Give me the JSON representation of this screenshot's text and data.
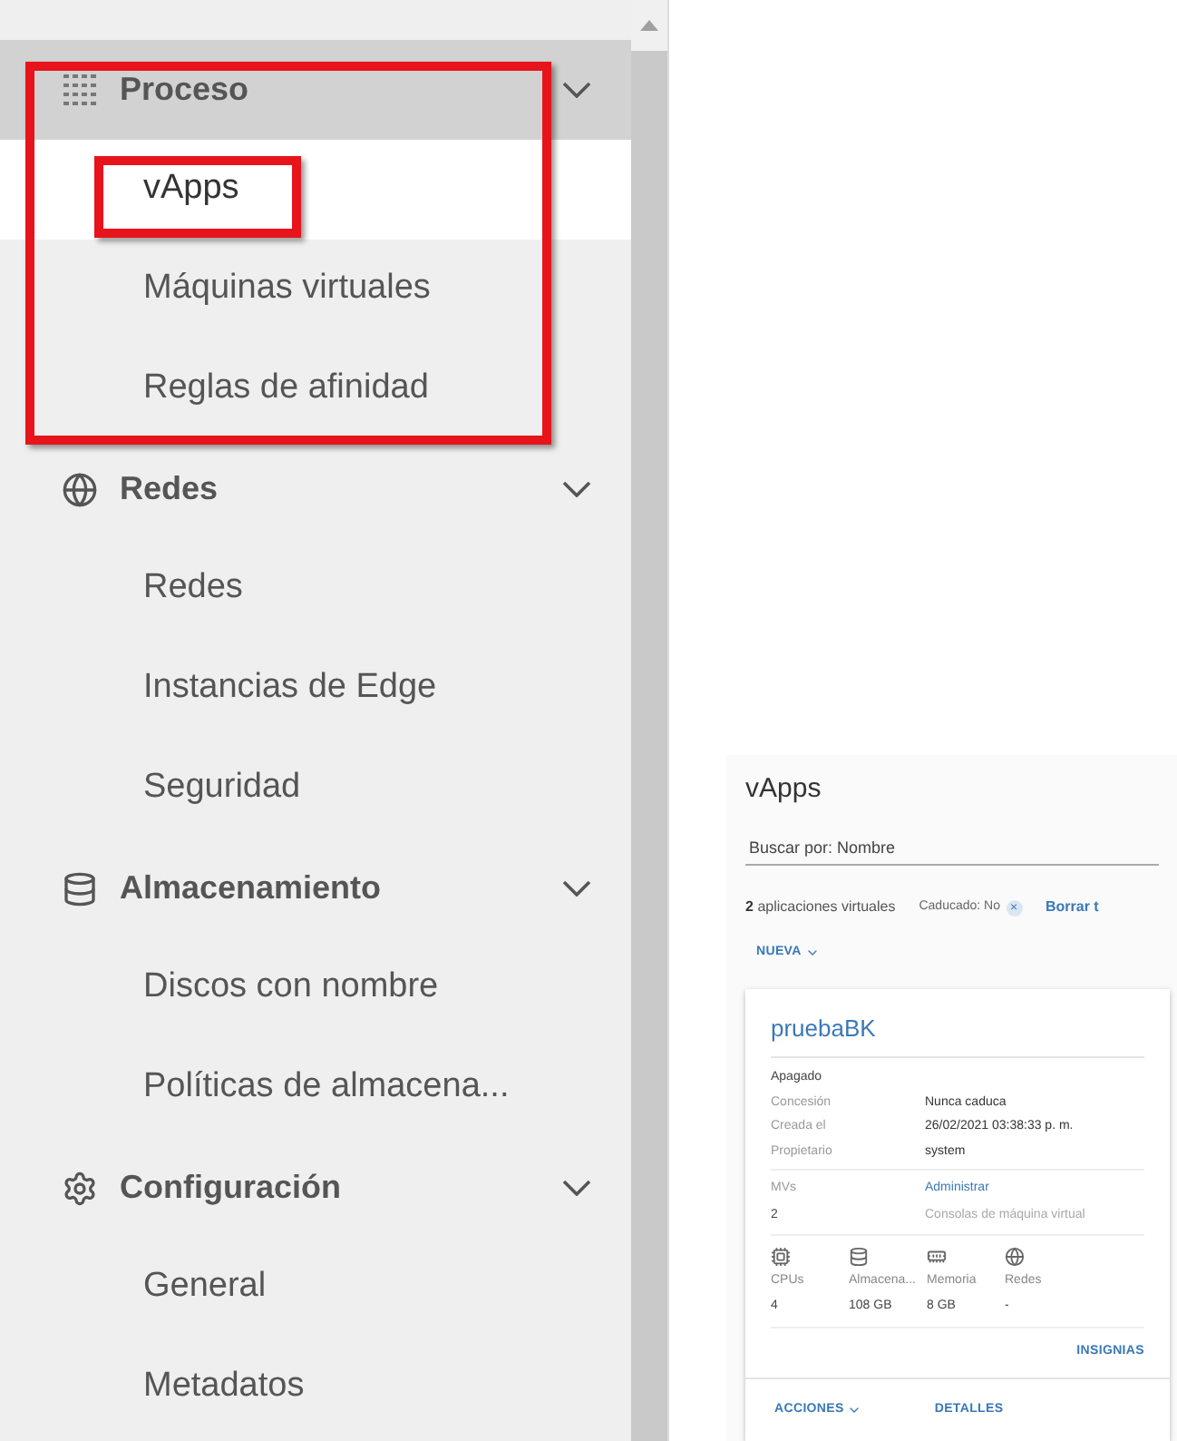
{
  "sidebar": {
    "groups": [
      {
        "label": "Proceso",
        "expanded": true,
        "selected": true,
        "highlighted": true,
        "items": [
          {
            "label": "vApps",
            "selected": true,
            "highlighted": true
          },
          {
            "label": "Máquinas virtuales",
            "selected": false,
            "highlighted": false
          },
          {
            "label": "Reglas de afinidad",
            "selected": false,
            "highlighted": false
          }
        ]
      },
      {
        "label": "Redes",
        "expanded": true,
        "selected": false,
        "highlighted": false,
        "items": [
          {
            "label": "Redes",
            "selected": false,
            "highlighted": false
          },
          {
            "label": "Instancias de Edge",
            "selected": false,
            "highlighted": false
          },
          {
            "label": "Seguridad",
            "selected": false,
            "highlighted": false
          }
        ]
      },
      {
        "label": "Almacenamiento",
        "expanded": true,
        "selected": false,
        "highlighted": false,
        "items": [
          {
            "label": "Discos con nombre",
            "selected": false,
            "highlighted": false
          },
          {
            "label": "Políticas de almacena...",
            "selected": false,
            "highlighted": false
          }
        ]
      },
      {
        "label": "Configuración",
        "expanded": true,
        "selected": false,
        "highlighted": false,
        "items": [
          {
            "label": "General",
            "selected": false,
            "highlighted": false
          },
          {
            "label": "Metadatos",
            "selected": false,
            "highlighted": false
          }
        ]
      }
    ]
  },
  "preview": {
    "title": "vApps",
    "search": {
      "value": "Buscar por: Nombre"
    },
    "count_bold": "2",
    "count_text": "aplicaciones virtuales",
    "filter": "Caducado: No",
    "filter_clear": "×",
    "clear_link": "Borrar t",
    "new_button": "NUEVA",
    "card": {
      "name": "pruebaBK",
      "status": "Apagado",
      "details": [
        {
          "label": "Concesión",
          "value": "Nunca caduca"
        },
        {
          "label": "Creada el",
          "value": "26/02/2021 03:38:33 p. m."
        },
        {
          "label": "Propietario",
          "value": "system"
        }
      ],
      "vms_label": "MVs",
      "vms_value": "2",
      "manage_link": "Administrar",
      "consoles_link": "Consolas de máquina virtual",
      "consoles_disabled": true,
      "resources": [
        {
          "label": "CPUs",
          "value": "4"
        },
        {
          "label": "Almacena...",
          "value": "108 GB"
        },
        {
          "label": "Memoria",
          "value": "8 GB"
        },
        {
          "label": "Redes",
          "value": "-"
        }
      ],
      "badges_button": "INSIGNIAS",
      "actions_button": "ACCIONES",
      "details_button": "DETALLES"
    }
  }
}
